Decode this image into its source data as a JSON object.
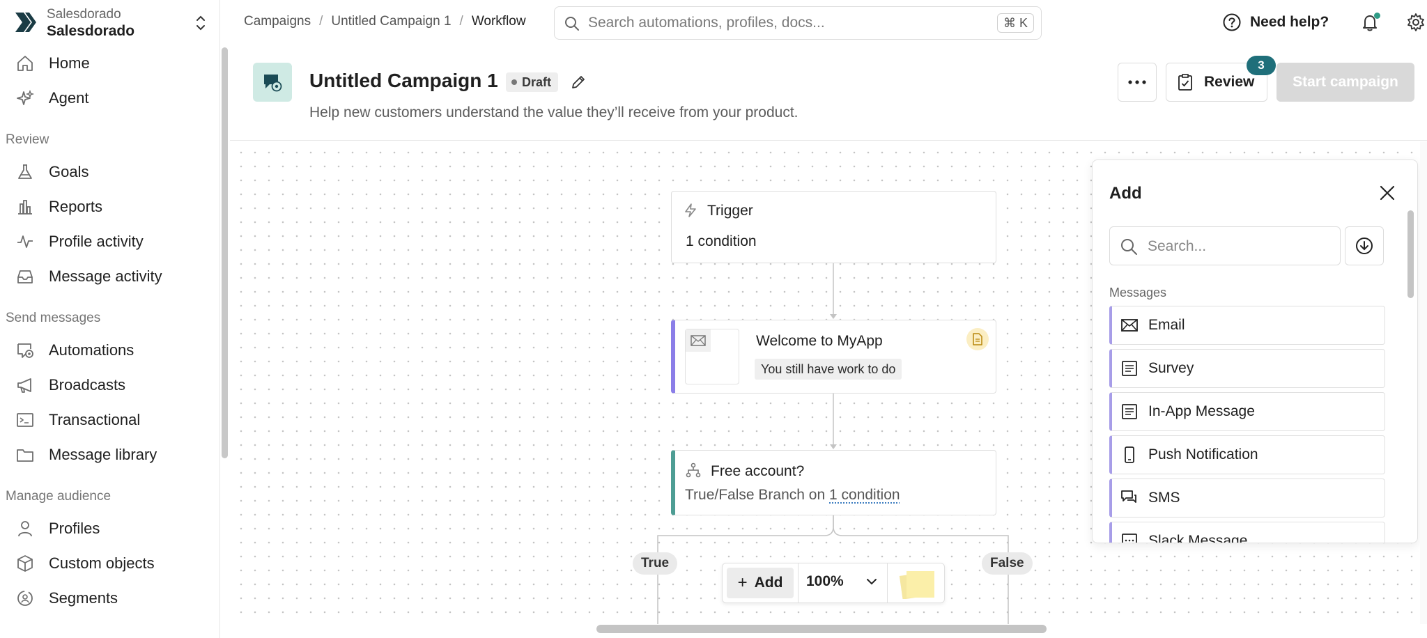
{
  "workspace": {
    "subtitle": "Salesdorado",
    "name": "Salesdorado"
  },
  "sidebar": {
    "home": "Home",
    "agent": "Agent",
    "review_section": "Review",
    "goals": "Goals",
    "reports": "Reports",
    "profile_activity": "Profile activity",
    "message_activity": "Message activity",
    "send_section": "Send messages",
    "automations": "Automations",
    "broadcasts": "Broadcasts",
    "transactional": "Transactional",
    "message_library": "Message library",
    "audience_section": "Manage audience",
    "profiles": "Profiles",
    "custom_objects": "Custom objects",
    "segments": "Segments"
  },
  "breadcrumb": {
    "campaigns": "Campaigns",
    "campaign": "Untitled Campaign 1",
    "current": "Workflow",
    "sep": "/"
  },
  "search": {
    "placeholder": "Search automations, profiles, docs...",
    "shortcut": "⌘ K"
  },
  "header": {
    "help": "Need help?"
  },
  "campaign": {
    "title": "Untitled Campaign 1",
    "status": "Draft",
    "description": "Help new customers understand the value they’ll receive from your product.",
    "review_label": "Review",
    "review_count": "3",
    "start_label": "Start campaign"
  },
  "workflow": {
    "trigger_title": "Trigger",
    "trigger_detail": "1 condition",
    "message_title": "Welcome to MyApp",
    "message_status": "You still have work to do",
    "branch_title": "Free account?",
    "branch_prefix": "True/False Branch on ",
    "branch_link": "1 condition",
    "true_label": "True",
    "false_label": "False"
  },
  "toolbar": {
    "add_label": "Add",
    "zoom": "100%"
  },
  "add_panel": {
    "title": "Add",
    "search_placeholder": "Search...",
    "section": "Messages",
    "items": [
      "Email",
      "Survey",
      "In-App Message",
      "Push Notification",
      "SMS",
      "Slack Message"
    ]
  },
  "colors": {
    "accent_teal": "#1f6f7a",
    "email_border": "#8b7ee8",
    "branch_border": "#4e9d94",
    "status_dot": "#2f9b86"
  }
}
